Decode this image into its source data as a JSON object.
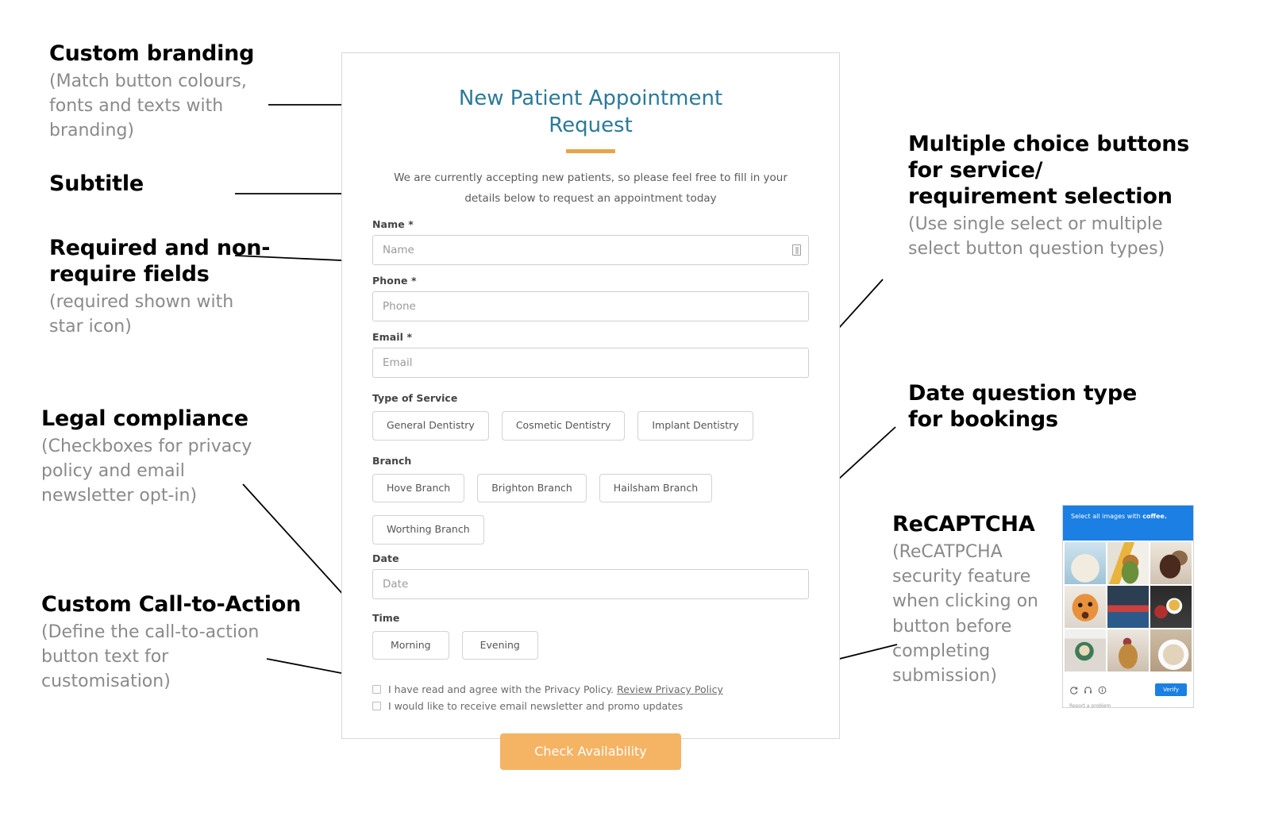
{
  "annotations": {
    "custom_branding": {
      "title": "Custom branding",
      "sub": "(Match button colours,\nfonts and texts with\nbranding)"
    },
    "subtitle": {
      "title": "Subtitle",
      "sub": ""
    },
    "required_fields": {
      "title": "Required and non-\nrequire fields",
      "sub": "(required shown with\nstar icon)"
    },
    "legal_compliance": {
      "title": "Legal compliance",
      "sub": "(Checkboxes for privacy\npolicy and email\nnewsletter opt-in)"
    },
    "custom_cta": {
      "title": "Custom Call-to-Action",
      "sub": "(Define the call-to-action\nbutton text for\ncustomisation)"
    },
    "multiple_choice": {
      "title": "Multiple choice buttons\nfor service/\nrequirement selection",
      "sub": "(Use single select or multiple\nselect button question types)"
    },
    "date_question": {
      "title": "Date question type\nfor bookings",
      "sub": ""
    },
    "recaptcha": {
      "title": "ReCAPTCHA",
      "sub": "(ReCATPCHA\nsecurity feature\nwhen clicking on\nbutton before\ncompleting\nsubmission)"
    }
  },
  "form": {
    "title": "New Patient Appointment Request",
    "subtitle": "We are currently accepting new patients, so please feel free to fill in your details below to request an appointment today",
    "accent_color": "#e8a44a",
    "title_color": "#2b7a99",
    "fields": [
      {
        "label": "Name",
        "required_mark": "*",
        "placeholder": "Name",
        "has_icon": true
      },
      {
        "label": "Phone",
        "required_mark": "*",
        "placeholder": "Phone",
        "has_icon": false
      },
      {
        "label": "Email",
        "required_mark": "*",
        "placeholder": "Email",
        "has_icon": false
      }
    ],
    "service_group": {
      "label": "Type of Service",
      "options": [
        "General Dentistry",
        "Cosmetic Dentistry",
        "Implant Dentistry"
      ]
    },
    "branch_group": {
      "label": "Branch",
      "options": [
        "Hove Branch",
        "Brighton Branch",
        "Hailsham Branch",
        "Worthing Branch"
      ]
    },
    "date_field": {
      "label": "Date",
      "placeholder": "Date"
    },
    "time_group": {
      "label": "Time",
      "options": [
        "Morning",
        "Evening"
      ]
    },
    "checkboxes": [
      {
        "text": "I have read and agree with  the Privacy Policy.",
        "link": "Review Privacy Policy",
        "checked": false
      },
      {
        "text": "I would like to receive email newsletter and promo updates",
        "link": "",
        "checked": false
      }
    ],
    "cta": {
      "label": "Check Availability",
      "color": "#f5b364"
    }
  },
  "captcha": {
    "prompt_prefix": "Select all images with ",
    "prompt_bold": "coffee.",
    "verify_label": "Verify",
    "report_label": "Report a problem",
    "header_color": "#1b7fe3",
    "cells": [
      "granola-yogurt-bowl",
      "burger-and-beer",
      "grilled-meat-plate",
      "orange-soup-face",
      "raspberry-dessert-tray",
      "espresso-cup-yellow",
      "latte-art-green-cup",
      "pie-slice-plate",
      "cappuccino-white-cup"
    ]
  }
}
